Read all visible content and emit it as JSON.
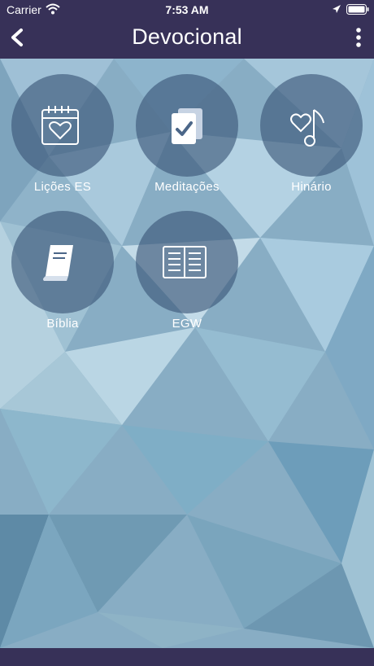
{
  "status_bar": {
    "carrier": "Carrier",
    "time": "7:53 AM"
  },
  "nav": {
    "title": "Devocional"
  },
  "tiles": [
    {
      "label": "Lições ES",
      "icon": "calendar-heart-icon"
    },
    {
      "label": "Meditações",
      "icon": "notes-check-icon"
    },
    {
      "label": "Hinário",
      "icon": "heart-music-note-icon"
    },
    {
      "label": "Bíblia",
      "icon": "book-icon"
    },
    {
      "label": "EGW",
      "icon": "open-book-icon"
    }
  ],
  "colors": {
    "bar": "#373158",
    "circle": "#395476",
    "background": "#7fa6bf"
  }
}
